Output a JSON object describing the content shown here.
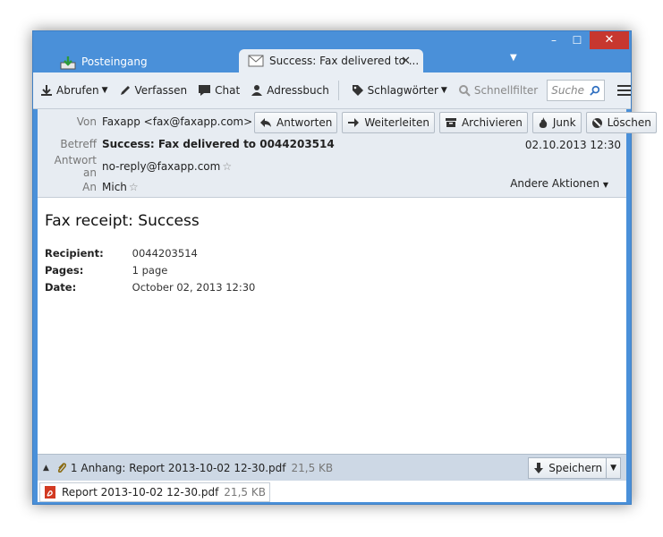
{
  "tabs": [
    {
      "label": "Posteingang",
      "icon": "inbox-icon"
    },
    {
      "label": "Success: Fax delivered to ...",
      "icon": "envelope-icon",
      "close": "✕"
    }
  ],
  "window_controls": {
    "minimize": "–",
    "maximize": "☐",
    "close": "✕"
  },
  "toolbar": {
    "get_mail": "Abrufen",
    "write": "Verfassen",
    "chat": "Chat",
    "address_book": "Adressbuch",
    "tags": "Schlagwörter",
    "quick_filter": "Schnellfilter",
    "search_placeholder": "Suche"
  },
  "header": {
    "labels": {
      "from": "Von",
      "subject": "Betreff",
      "reply_to": "Antwort an",
      "to": "An"
    },
    "from": "Faxapp <fax@faxapp.com>",
    "subject": "Success: Fax delivered to 0044203514",
    "reply_to": "no-reply@faxapp.com",
    "to": "Mich",
    "date": "02.10.2013 12:30",
    "buttons": {
      "reply": "Antworten",
      "forward": "Weiterleiten",
      "archive": "Archivieren",
      "junk": "Junk",
      "delete": "Löschen"
    },
    "other_actions": "Andere Aktionen"
  },
  "message": {
    "title": "Fax receipt: Success",
    "fields": [
      {
        "key": "Recipient:",
        "value": "0044203514"
      },
      {
        "key": "Pages:",
        "value": "1 page"
      },
      {
        "key": "Date:",
        "value": "October 02, 2013 12:30"
      }
    ]
  },
  "attachments": {
    "summary": "1 Anhang: Report 2013-10-02 12-30.pdf",
    "summary_size": "21,5 KB",
    "save": "Speichern",
    "items": [
      {
        "name": "Report 2013-10-02 12-30.pdf",
        "size": "21,5 KB"
      }
    ]
  },
  "colors": {
    "frame": "#4a90d9",
    "close": "#c7372f",
    "toolbar": "#e9eef4",
    "attachment_bar": "#cdd8e5"
  }
}
